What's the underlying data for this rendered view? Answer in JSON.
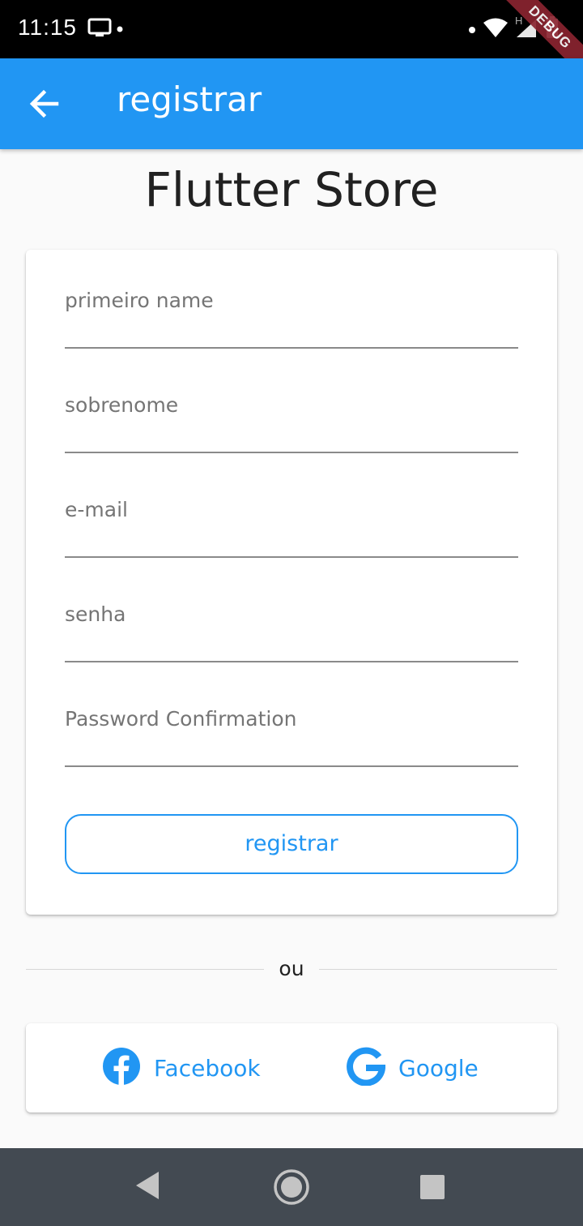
{
  "status_bar": {
    "time": "11:15",
    "debug_label": "DEBUG",
    "network_letter": "H"
  },
  "app_bar": {
    "title": "registrar"
  },
  "page": {
    "title": "Flutter Store"
  },
  "form": {
    "fields": [
      {
        "label": "primeiro name"
      },
      {
        "label": "sobrenome"
      },
      {
        "label": "e-mail"
      },
      {
        "label": "senha"
      },
      {
        "label": "Password Confirmation"
      }
    ],
    "submit_label": "registrar"
  },
  "divider": {
    "text": "ou"
  },
  "social": {
    "facebook_label": "Facebook",
    "google_label": "Google"
  },
  "colors": {
    "primary": "#2196f3",
    "background": "#fafafa",
    "nav_bar": "#434a52"
  }
}
